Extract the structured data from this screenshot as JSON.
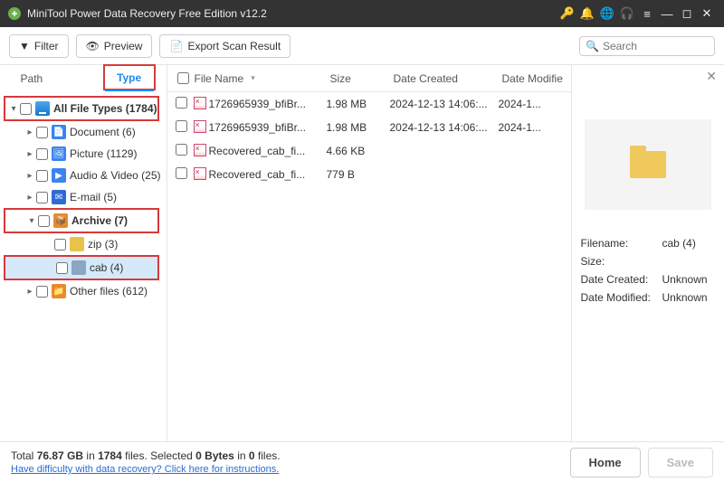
{
  "titlebar": {
    "title": "MiniTool Power Data Recovery Free Edition v12.2"
  },
  "toolbar": {
    "filter_label": "Filter",
    "preview_label": "Preview",
    "export_label": "Export Scan Result",
    "search_placeholder": "Search"
  },
  "left": {
    "tabs": {
      "path": "Path",
      "type": "Type"
    },
    "nodes": {
      "all": {
        "label": "All File Types (1784)"
      },
      "document": {
        "label": "Document (6)"
      },
      "picture": {
        "label": "Picture (1129)"
      },
      "av": {
        "label": "Audio & Video (25)"
      },
      "email": {
        "label": "E-mail (5)"
      },
      "archive": {
        "label": "Archive (7)"
      },
      "zip": {
        "label": "zip (3)"
      },
      "cab": {
        "label": "cab (4)"
      },
      "other": {
        "label": "Other files (612)"
      }
    }
  },
  "list": {
    "headers": {
      "name": "File Name",
      "size": "Size",
      "created": "Date Created",
      "modified": "Date Modifie"
    },
    "rows": [
      {
        "name": "1726965939_bfiBr...",
        "size": "1.98 MB",
        "created": "2024-12-13 14:06:...",
        "modified": "2024-1..."
      },
      {
        "name": "1726965939_bfiBr...",
        "size": "1.98 MB",
        "created": "2024-12-13 14:06:...",
        "modified": "2024-1..."
      },
      {
        "name": "Recovered_cab_fi...",
        "size": "4.66 KB",
        "created": "",
        "modified": ""
      },
      {
        "name": "Recovered_cab_fi...",
        "size": "779 B",
        "created": "",
        "modified": ""
      }
    ]
  },
  "preview": {
    "labels": {
      "filename": "Filename:",
      "size": "Size:",
      "created": "Date Created:",
      "modified": "Date Modified:"
    },
    "values": {
      "filename": "cab (4)",
      "size": "",
      "created": "Unknown",
      "modified": "Unknown"
    }
  },
  "footer": {
    "stats_prefix": "Total ",
    "total_size": "76.87 GB",
    "in_word": " in ",
    "total_files": "1784",
    "files_word": " files.  Selected ",
    "sel_size": "0 Bytes",
    "in_word2": " in ",
    "sel_files": "0",
    "files_word2": " files.",
    "help_link": "Have difficulty with data recovery? Click here for instructions.",
    "home": "Home",
    "save": "Save"
  }
}
